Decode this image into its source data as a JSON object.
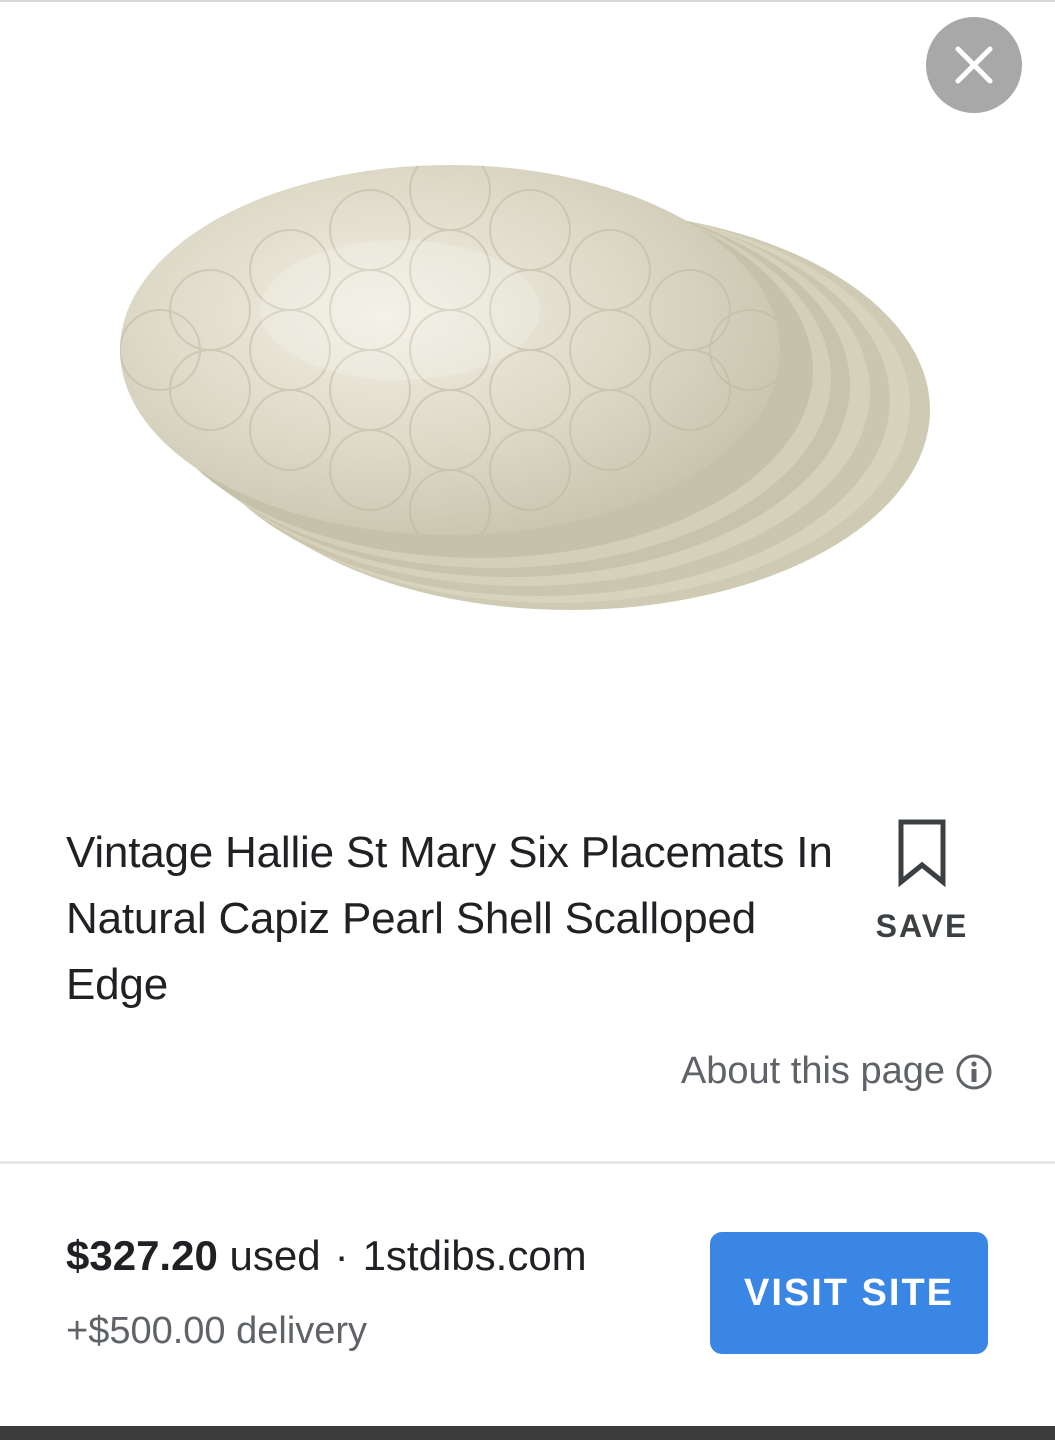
{
  "close": {
    "icon": "close-icon"
  },
  "product": {
    "image_alt_icon": "capiz-placemats-image",
    "title": "Vintage Hallie St Mary Six Placemats In Natural Capiz Pearl Shell Scalloped Edge"
  },
  "save": {
    "label": "SAVE",
    "icon": "bookmark-icon"
  },
  "about": {
    "label": "About this page",
    "icon": "info-icon"
  },
  "offer": {
    "price": "$327.20",
    "condition": "used",
    "separator": "·",
    "site": "1stdibs.com",
    "delivery": "+$500.00 delivery"
  },
  "visit": {
    "label": "VISIT SITE"
  },
  "colors": {
    "accent": "#3a86e5",
    "close_bg": "#a8a8a8",
    "text_primary": "#202124",
    "text_secondary": "#5f6368"
  }
}
